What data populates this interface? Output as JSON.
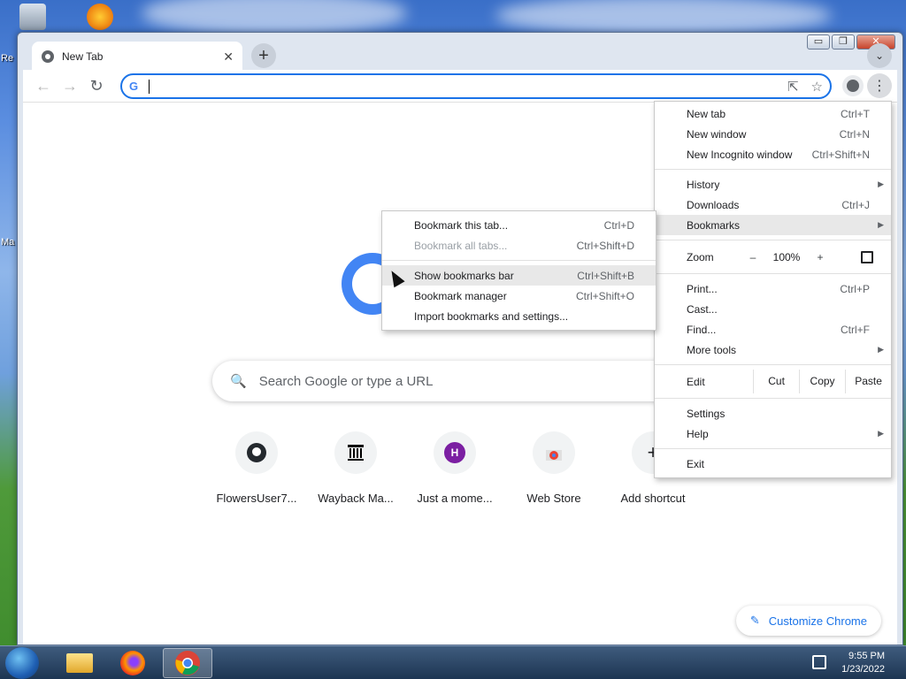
{
  "desktop": {
    "left_labels": [
      "Re",
      "Ma"
    ]
  },
  "window": {
    "controls": {
      "minimize": "▭",
      "maximize": "❐",
      "close": "✕"
    }
  },
  "tab": {
    "title": "New Tab",
    "close": "✕"
  },
  "toolbar": {
    "back": "←",
    "forward": "→",
    "reload": "↻",
    "omnibox_icon": "G",
    "omnibox_value": "",
    "share_icon": "⇱",
    "star_icon": "☆",
    "menu_icon": "⋮",
    "new_tab_icon": "+",
    "tab_search_icon": "⌄"
  },
  "ntp": {
    "search_placeholder": "Search Google or type a URL",
    "shortcuts": [
      {
        "label": "FlowersUser7...",
        "icon": "github-icon"
      },
      {
        "label": "Wayback Ma...",
        "icon": "archive-icon"
      },
      {
        "label": "Just a mome...",
        "icon": "h-letter-icon",
        "letter": "H"
      },
      {
        "label": "Web Store",
        "icon": "web-store-icon"
      },
      {
        "label": "Add shortcut",
        "icon": "plus-icon",
        "glyph": "+"
      }
    ],
    "customize_label": "Customize Chrome"
  },
  "chrome_menu": {
    "new_tab": {
      "label": "New tab",
      "shortcut": "Ctrl+T"
    },
    "new_window": {
      "label": "New window",
      "shortcut": "Ctrl+N"
    },
    "new_incognito": {
      "label": "New Incognito window",
      "shortcut": "Ctrl+Shift+N"
    },
    "history": {
      "label": "History"
    },
    "downloads": {
      "label": "Downloads",
      "shortcut": "Ctrl+J"
    },
    "bookmarks": {
      "label": "Bookmarks"
    },
    "zoom": {
      "label": "Zoom",
      "minus": "–",
      "value": "100%",
      "plus": "+"
    },
    "print": {
      "label": "Print...",
      "shortcut": "Ctrl+P"
    },
    "cast": {
      "label": "Cast..."
    },
    "find": {
      "label": "Find...",
      "shortcut": "Ctrl+F"
    },
    "more_tools": {
      "label": "More tools"
    },
    "edit": {
      "label": "Edit",
      "cut": "Cut",
      "copy": "Copy",
      "paste": "Paste"
    },
    "settings": {
      "label": "Settings"
    },
    "help": {
      "label": "Help"
    },
    "exit": {
      "label": "Exit"
    }
  },
  "bookmarks_menu": {
    "bookmark_tab": {
      "label": "Bookmark this tab...",
      "shortcut": "Ctrl+D"
    },
    "bookmark_all": {
      "label": "Bookmark all tabs...",
      "shortcut": "Ctrl+Shift+D"
    },
    "show_bar": {
      "label": "Show bookmarks bar",
      "shortcut": "Ctrl+Shift+B"
    },
    "manager": {
      "label": "Bookmark manager",
      "shortcut": "Ctrl+Shift+O"
    },
    "import": {
      "label": "Import bookmarks and settings..."
    }
  },
  "taskbar": {
    "clock_time": "9:55 PM",
    "clock_date": "1/23/2022"
  },
  "colors": {
    "accent": "#1a73e8",
    "google_blue": "#4285f4",
    "avatar_purple": "#7b1fa2"
  }
}
